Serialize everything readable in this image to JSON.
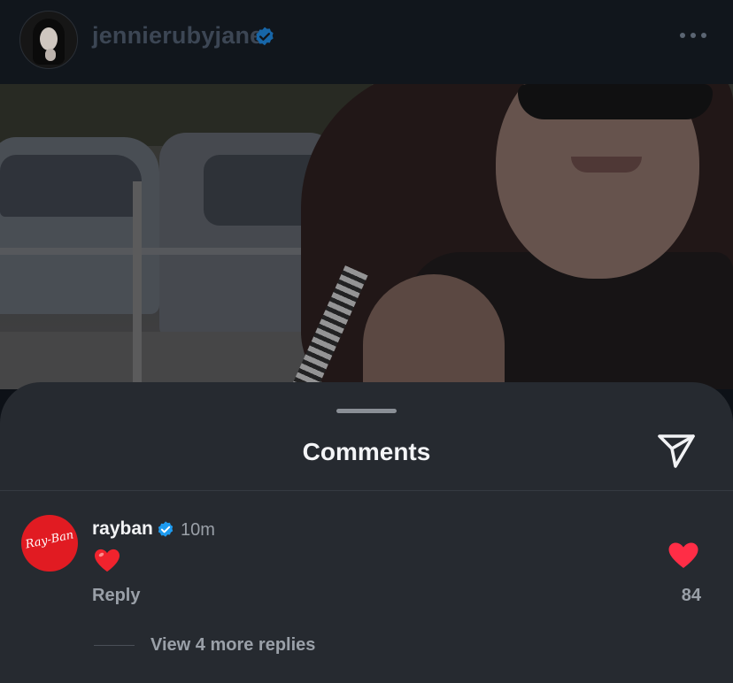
{
  "post": {
    "username": "jennierubyjane",
    "avatar_icon": "profile-avatar",
    "verified_icon": "verified-badge-icon",
    "more_icon": "more-dots-icon"
  },
  "comments_sheet": {
    "title": "Comments",
    "share_icon": "send-icon",
    "comments": [
      {
        "username": "rayban",
        "avatar_brand": "Ray-Ban",
        "time": "10m",
        "text_emoji": "red-heart-emoji",
        "reply_label": "Reply",
        "like_icon": "heart-filled-icon",
        "like_count": "84",
        "view_replies": "View 4 more replies"
      }
    ]
  },
  "colors": {
    "accent_verified": "#1d9bf0",
    "like_red": "#ff2d46",
    "sheet_bg": "#262a30"
  }
}
